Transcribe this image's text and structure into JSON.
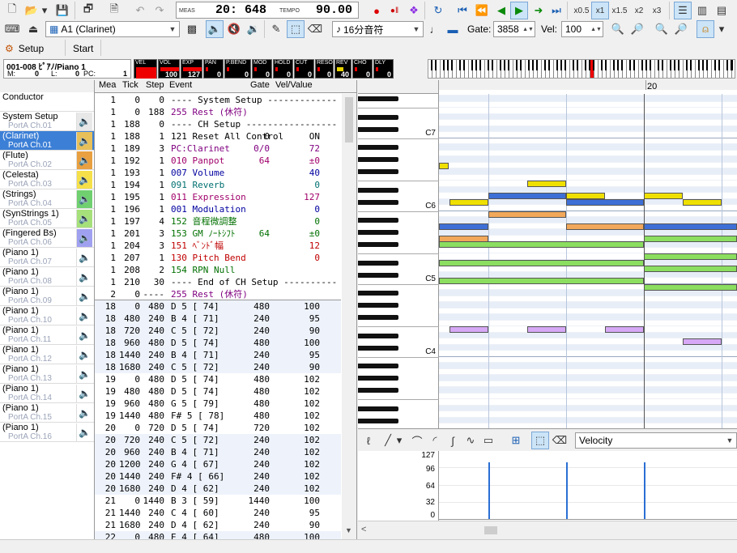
{
  "toolbar": {
    "meas_label": "MEAS",
    "meas_value": "20: 648",
    "tempo_label": "TEMPO",
    "tempo_value": "90.00",
    "speeds": [
      "x0.5",
      "x1",
      "x1.5",
      "x2",
      "x3"
    ]
  },
  "toolbar2": {
    "track_select": "A1  (Clarinet)",
    "note_length": "16分音符",
    "gate_label": "Gate:",
    "gate_value": "3858",
    "vel_label": "Vel:",
    "vel_value": "100"
  },
  "toolbar3": {
    "setup_label": "Setup",
    "start_label": "Start"
  },
  "status": {
    "track_name": "001-008 ﾋﾟｱﾉ/Piano 1",
    "m_label": "M:",
    "m_value": "0",
    "l_label": "L:",
    "l_value": "0",
    "pc_label": "PC:",
    "pc_value": "1",
    "meter_labels": [
      "VEL",
      "VOL",
      "EXP",
      "PAN",
      "P.BEND",
      "MOD",
      "HOLD",
      "CUT",
      "RESO",
      "REV",
      "CHO",
      "DLY"
    ],
    "meter_values": [
      "",
      "100",
      "127",
      "0",
      "0",
      "0",
      "0",
      "0",
      "0",
      "40",
      "0",
      "0"
    ]
  },
  "tracks": [
    {
      "name": "Conductor",
      "port": ""
    },
    {
      "name": "System Setup",
      "port": "PortA  Ch.01"
    },
    {
      "name": "(Clarinet)",
      "port": "PortA  Ch.01"
    },
    {
      "name": "(Flute)",
      "port": "PortA  Ch.02"
    },
    {
      "name": "(Celesta)",
      "port": "PortA  Ch.03"
    },
    {
      "name": "(Strings)",
      "port": "PortA  Ch.04"
    },
    {
      "name": "(SynStrings 1)",
      "port": "PortA  Ch.05"
    },
    {
      "name": "(Fingered Bs)",
      "port": "PortA  Ch.06"
    },
    {
      "name": "(Piano 1)",
      "port": "PortA  Ch.07"
    },
    {
      "name": "(Piano 1)",
      "port": "PortA  Ch.08"
    },
    {
      "name": "(Piano 1)",
      "port": "PortA  Ch.09"
    },
    {
      "name": "(Piano 1)",
      "port": "PortA  Ch.10"
    },
    {
      "name": "(Piano 1)",
      "port": "PortA  Ch.11"
    },
    {
      "name": "(Piano 1)",
      "port": "PortA  Ch.12"
    },
    {
      "name": "(Piano 1)",
      "port": "PortA  Ch.13"
    },
    {
      "name": "(Piano 1)",
      "port": "PortA  Ch.14"
    },
    {
      "name": "(Piano 1)",
      "port": "PortA  Ch.15"
    },
    {
      "name": "(Piano 1)",
      "port": "PortA  Ch.16"
    }
  ],
  "event_headers": [
    "Mea",
    "Tick",
    "Step",
    "Event",
    "Gate",
    "Vel/Value"
  ],
  "events": [
    {
      "mea": "1",
      "tick": "0",
      "step": "0",
      "event": "---- System Setup -------------",
      "gate": "",
      "val": "",
      "color": "#000"
    },
    {
      "mea": "1",
      "tick": "0",
      "step": "188",
      "event": "255 Rest (休符)",
      "gate": "",
      "val": "",
      "color": "#800080"
    },
    {
      "mea": "1",
      "tick": "188",
      "step": "0",
      "event": "---- CH Setup -----------------",
      "gate": "",
      "val": "",
      "color": "#000"
    },
    {
      "mea": "1",
      "tick": "188",
      "step": "1",
      "event": "121 Reset All Control",
      "gate": "0",
      "val": "ON",
      "color": "#000"
    },
    {
      "mea": "1",
      "tick": "189",
      "step": "3",
      "event": "PC:Clarinet",
      "gate": "0/0",
      "val": "72",
      "color": "#800080"
    },
    {
      "mea": "1",
      "tick": "192",
      "step": "1",
      "event": "010 Panpot",
      "gate": "64",
      "val": "±0",
      "color": "#a0006a"
    },
    {
      "mea": "1",
      "tick": "193",
      "step": "1",
      "event": "007 Volume",
      "gate": "",
      "val": "40",
      "color": "#0000a0"
    },
    {
      "mea": "1",
      "tick": "194",
      "step": "1",
      "event": "091 Reverb",
      "gate": "",
      "val": "0",
      "color": "#007070"
    },
    {
      "mea": "1",
      "tick": "195",
      "step": "1",
      "event": "011 Expression",
      "gate": "",
      "val": "127",
      "color": "#a0006a"
    },
    {
      "mea": "1",
      "tick": "196",
      "step": "1",
      "event": "001 Modulation",
      "gate": "",
      "val": "0",
      "color": "#0000a0"
    },
    {
      "mea": "1",
      "tick": "197",
      "step": "4",
      "event": "152 音程微調整",
      "gate": "",
      "val": "0",
      "color": "#007000"
    },
    {
      "mea": "1",
      "tick": "201",
      "step": "3",
      "event": "153 GM ﾉｰﾄｼﾌﾄ",
      "gate": "64",
      "val": "±0",
      "color": "#007000"
    },
    {
      "mea": "1",
      "tick": "204",
      "step": "3",
      "event": "151 ﾍﾞﾝﾄﾞ幅",
      "gate": "",
      "val": "12",
      "color": "#c00000"
    },
    {
      "mea": "1",
      "tick": "207",
      "step": "1",
      "event": "130 Pitch Bend",
      "gate": "",
      "val": "0",
      "color": "#c00000"
    },
    {
      "mea": "1",
      "tick": "208",
      "step": "2",
      "event": "154 RPN Null",
      "gate": "",
      "val": "",
      "color": "#007000"
    },
    {
      "mea": "1",
      "tick": "210",
      "step": "30",
      "event": "---- End of CH Setup ----------",
      "gate": "",
      "val": "",
      "color": "#000"
    },
    {
      "mea": "2",
      "tick": "0",
      "step": "----",
      "event": "255 Rest (休符)",
      "gate": "",
      "val": "",
      "color": "#800080"
    },
    {
      "mea": "18",
      "tick": "0",
      "step": "480",
      "event": "D  5 [ 74]",
      "gate": "480",
      "val": "100",
      "color": "#000"
    },
    {
      "mea": "18",
      "tick": "480",
      "step": "240",
      "event": "B  4 [ 71]",
      "gate": "240",
      "val": "95",
      "color": "#000"
    },
    {
      "mea": "18",
      "tick": "720",
      "step": "240",
      "event": "C  5 [ 72]",
      "gate": "240",
      "val": "90",
      "color": "#000"
    },
    {
      "mea": "18",
      "tick": "960",
      "step": "480",
      "event": "D  5 [ 74]",
      "gate": "480",
      "val": "100",
      "color": "#000"
    },
    {
      "mea": "18",
      "tick": "1440",
      "step": "240",
      "event": "B  4 [ 71]",
      "gate": "240",
      "val": "95",
      "color": "#000"
    },
    {
      "mea": "18",
      "tick": "1680",
      "step": "240",
      "event": "C  5 [ 72]",
      "gate": "240",
      "val": "90",
      "color": "#000"
    },
    {
      "mea": "19",
      "tick": "0",
      "step": "480",
      "event": "D  5 [ 74]",
      "gate": "480",
      "val": "102",
      "color": "#000"
    },
    {
      "mea": "19",
      "tick": "480",
      "step": "480",
      "event": "D  5 [ 74]",
      "gate": "480",
      "val": "102",
      "color": "#000"
    },
    {
      "mea": "19",
      "tick": "960",
      "step": "480",
      "event": "G  5 [ 79]",
      "gate": "480",
      "val": "102",
      "color": "#000"
    },
    {
      "mea": "19",
      "tick": "1440",
      "step": "480",
      "event": "F# 5 [ 78]",
      "gate": "480",
      "val": "102",
      "color": "#000"
    },
    {
      "mea": "20",
      "tick": "0",
      "step": "720",
      "event": "D  5 [ 74]",
      "gate": "720",
      "val": "102",
      "color": "#000"
    },
    {
      "mea": "20",
      "tick": "720",
      "step": "240",
      "event": "C  5 [ 72]",
      "gate": "240",
      "val": "102",
      "color": "#000"
    },
    {
      "mea": "20",
      "tick": "960",
      "step": "240",
      "event": "B  4 [ 71]",
      "gate": "240",
      "val": "102",
      "color": "#000"
    },
    {
      "mea": "20",
      "tick": "1200",
      "step": "240",
      "event": "G  4 [ 67]",
      "gate": "240",
      "val": "102",
      "color": "#000"
    },
    {
      "mea": "20",
      "tick": "1440",
      "step": "240",
      "event": "F# 4 [ 66]",
      "gate": "240",
      "val": "102",
      "color": "#000"
    },
    {
      "mea": "20",
      "tick": "1680",
      "step": "240",
      "event": "D  4 [ 62]",
      "gate": "240",
      "val": "102",
      "color": "#000"
    },
    {
      "mea": "21",
      "tick": "0",
      "step": "1440",
      "event": "B  3 [ 59]",
      "gate": "1440",
      "val": "100",
      "color": "#000"
    },
    {
      "mea": "21",
      "tick": "1440",
      "step": "240",
      "event": "C  4 [ 60]",
      "gate": "240",
      "val": "95",
      "color": "#000"
    },
    {
      "mea": "21",
      "tick": "1680",
      "step": "240",
      "event": "D  4 [ 62]",
      "gate": "240",
      "val": "90",
      "color": "#000"
    },
    {
      "mea": "22",
      "tick": "0",
      "step": "480",
      "event": "E  4 [ 64]",
      "gate": "480",
      "val": "100",
      "color": "#000"
    }
  ],
  "piano_roll": {
    "measure_label": "20",
    "octave_labels": [
      "C7",
      "C6",
      "C5",
      "C4"
    ]
  },
  "velocity_panel": {
    "select": "Velocity",
    "scale": [
      "127",
      "96",
      "64",
      "32",
      "0"
    ]
  },
  "colors": {
    "selected": "#3c7fd6",
    "grid": "#dfe7f3"
  }
}
